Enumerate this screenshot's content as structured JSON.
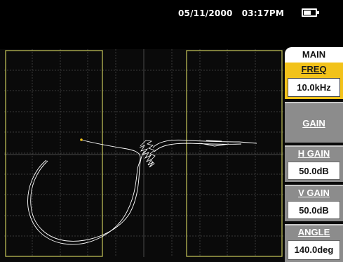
{
  "status": {
    "date": "05/11/2000",
    "time": "03:17PM",
    "battery_level": 0.6
  },
  "menu": {
    "title": "MAIN",
    "freq_label": "FREQ",
    "freq_value": "10.0kHz",
    "gain_label": "GAIN",
    "h_gain_label": "H GAIN",
    "h_gain_value": "50.0dB",
    "v_gain_label": "V GAIN",
    "v_gain_value": "50.0dB",
    "angle_label": "ANGLE",
    "angle_value": "140.0deg"
  },
  "colors": {
    "background": "#0a0a0a",
    "grid": "#3a3a3a",
    "gate": "#c8c85a",
    "signal": "#ffffff",
    "selected": "#f2c21a",
    "menu_inactive": "#8c8c8c"
  }
}
